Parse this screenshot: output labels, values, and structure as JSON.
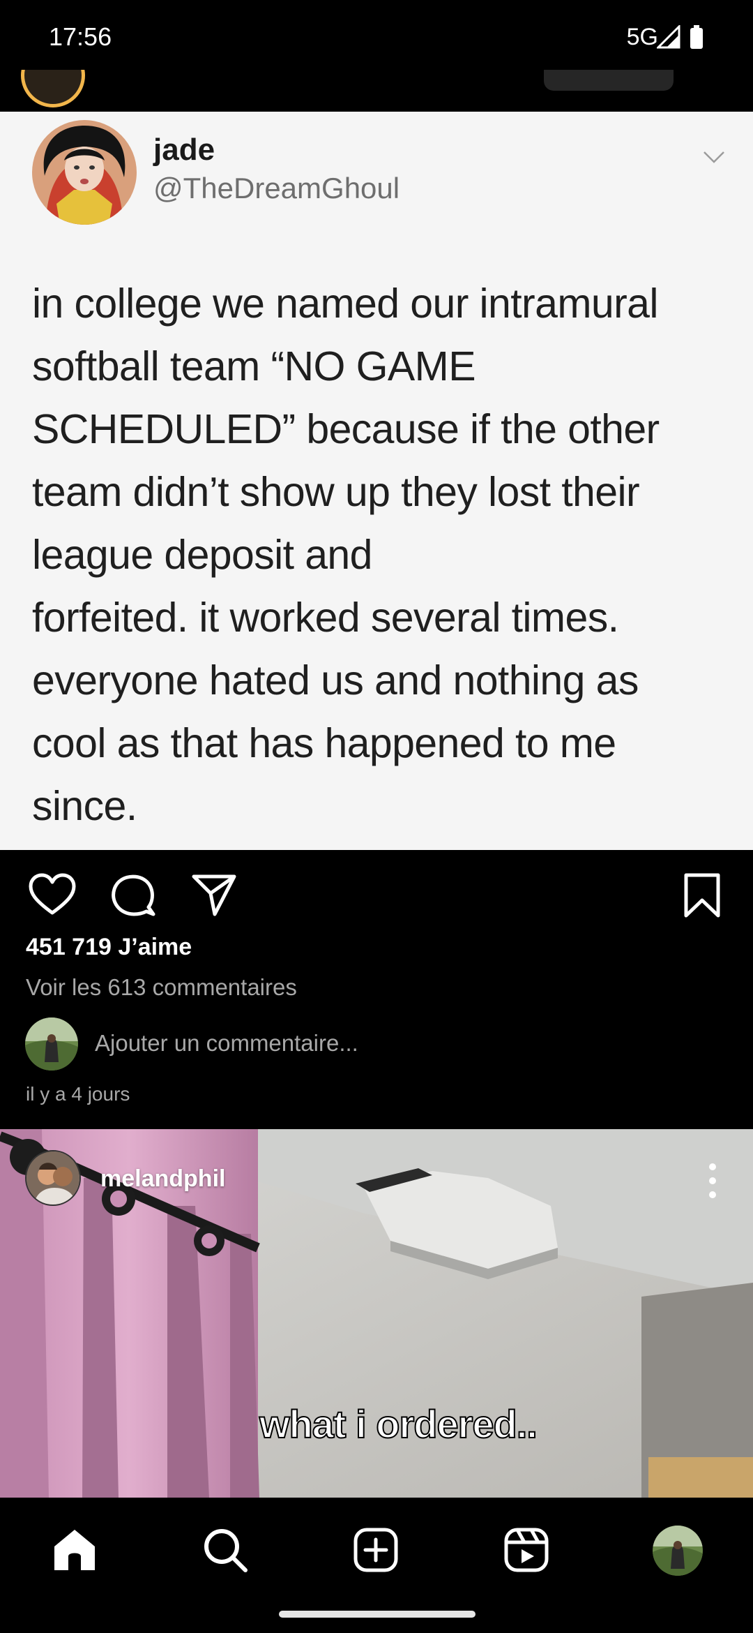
{
  "status_bar": {
    "time": "17:56",
    "network": "5G"
  },
  "tweet": {
    "name": "jade",
    "handle": "@TheDreamGhoul",
    "text": "in college we named our intramural\nsoftball team “NO GAME\nSCHEDULED” because if the other\nteam didn’t show up they lost their\nleague deposit and\nforfeited. it worked several times.\neveryone hated us and nothing as\ncool as that has happened to me\nsince."
  },
  "post": {
    "likes": "451 719 J’aime",
    "comments_link": "Voir les 613 commentaires",
    "add_comment_placeholder": "Ajouter un commentaire...",
    "time_ago": "il y a 4 jours"
  },
  "next_post": {
    "username": "melandphil",
    "caption": "what i ordered.."
  },
  "icons": {
    "like": "heart-icon",
    "comment": "comment-icon",
    "share": "send-icon",
    "save": "bookmark-icon",
    "home": "home-icon",
    "search": "search-icon",
    "create": "add-icon",
    "reels": "reels-icon"
  },
  "colors": {
    "background": "#000000",
    "tweet_background": "#f5f5f5",
    "secondary_text": "#a8a8a8",
    "story_ring": "#f2b64b"
  }
}
